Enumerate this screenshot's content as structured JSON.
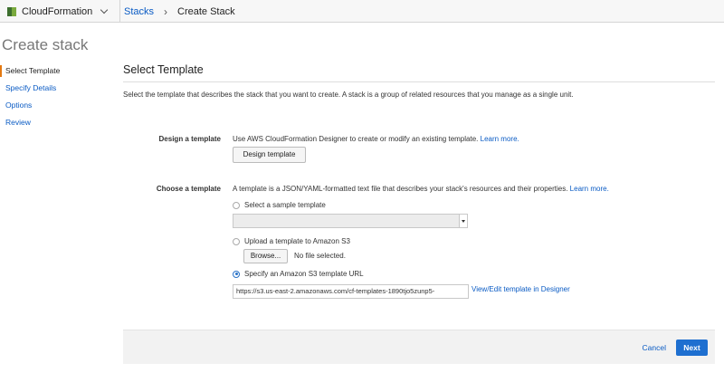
{
  "header": {
    "service_name": "CloudFormation",
    "breadcrumb": [
      "Stacks",
      "Create Stack"
    ]
  },
  "page_title": "Create stack",
  "sidebar": {
    "items": [
      {
        "label": "Select Template",
        "active": true
      },
      {
        "label": "Specify Details",
        "active": false
      },
      {
        "label": "Options",
        "active": false
      },
      {
        "label": "Review",
        "active": false
      }
    ]
  },
  "main": {
    "section_title": "Select Template",
    "intro": "Select the template that describes the stack that you want to create. A stack is a group of related resources that you manage as a single unit.",
    "design": {
      "label": "Design a template",
      "text": "Use AWS CloudFormation Designer to create or modify an existing template.",
      "learn_more": "Learn more.",
      "button": "Design template"
    },
    "choose": {
      "label": "Choose a template",
      "text": "A template is a JSON/YAML-formatted text file that describes your stack's resources and their properties.",
      "learn_more": "Learn more.",
      "options": [
        {
          "label": "Select a sample template",
          "selected": false
        },
        {
          "label": "Upload a template to Amazon S3",
          "selected": false
        },
        {
          "label": "Specify an Amazon S3 template URL",
          "selected": true
        }
      ],
      "sample_select_value": "",
      "browse_button": "Browse...",
      "no_file": "No file selected.",
      "url_value": "https://s3.us-east-2.amazonaws.com/cf-templates-1890tjo5zunp5-",
      "view_edit_link": "View/Edit template in Designer"
    }
  },
  "footer": {
    "cancel": "Cancel",
    "next": "Next"
  },
  "colors": {
    "link": "#0a5bc4",
    "primary_button": "#1e6fd0",
    "active_nav_marker": "#e47911"
  }
}
